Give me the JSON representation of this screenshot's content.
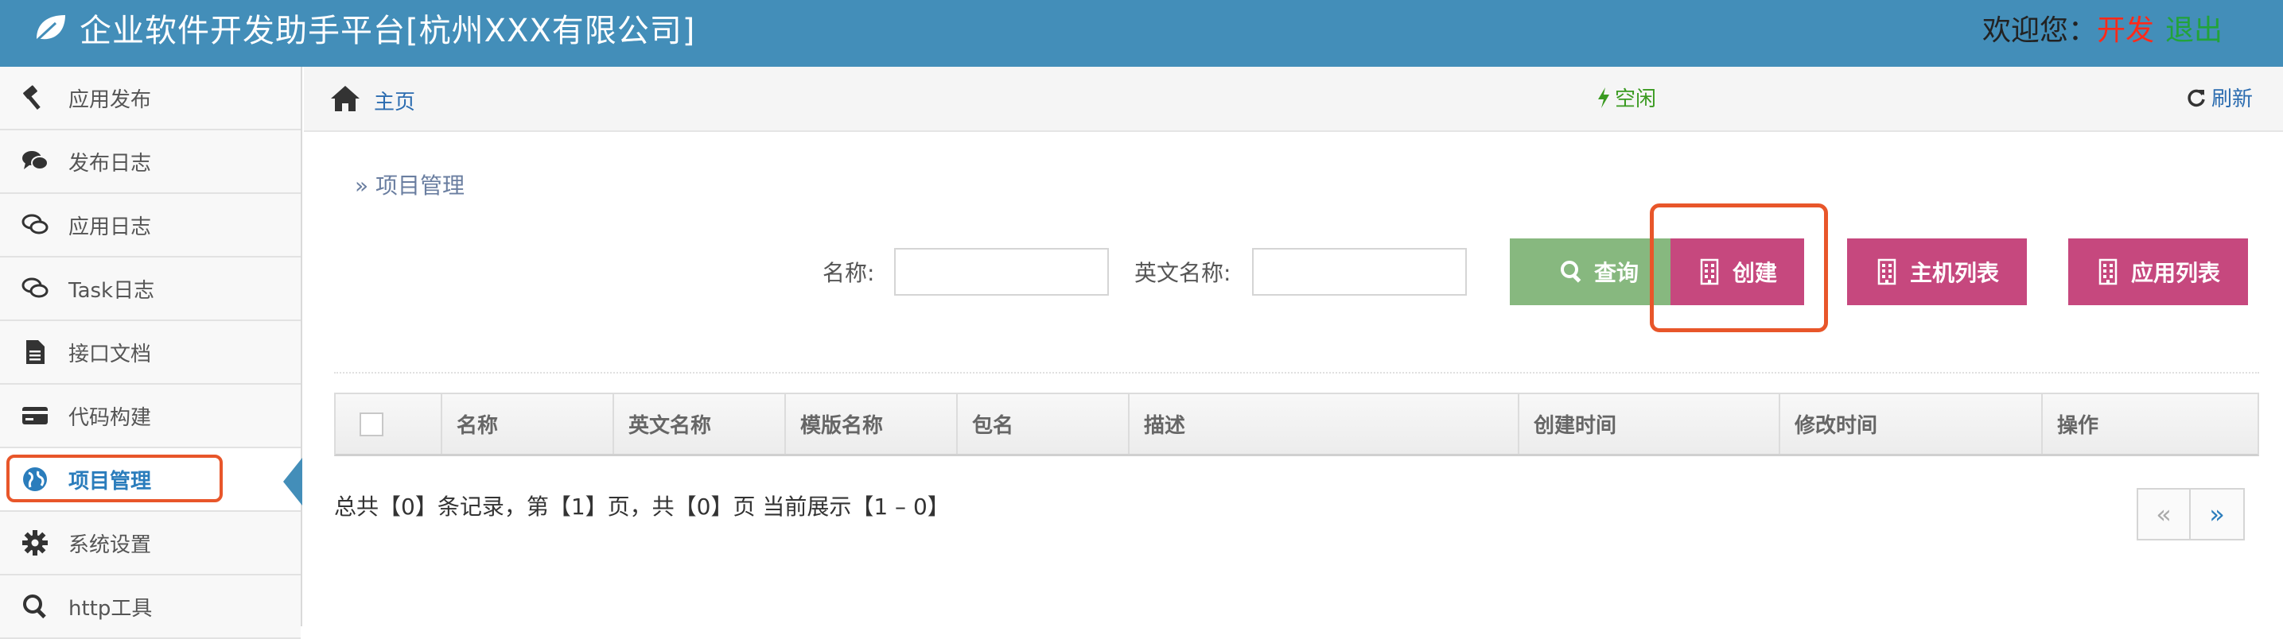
{
  "header": {
    "title": "企业软件开发助手平台[杭州XXX有限公司]",
    "welcome": "欢迎您：",
    "env": "开发",
    "logout": "退出"
  },
  "sidebar": {
    "items": [
      {
        "label": "应用发布",
        "icon": "hammer-icon"
      },
      {
        "label": "发布日志",
        "icon": "comments-icon"
      },
      {
        "label": "应用日志",
        "icon": "comments-outline-icon"
      },
      {
        "label": "Task日志",
        "icon": "comments-outline-icon"
      },
      {
        "label": "接口文档",
        "icon": "file-text-icon"
      },
      {
        "label": "代码构建",
        "icon": "credit-card-icon"
      },
      {
        "label": "项目管理",
        "icon": "globe-icon",
        "active": true
      },
      {
        "label": "系统设置",
        "icon": "gear-icon"
      },
      {
        "label": "http工具",
        "icon": "search-icon"
      }
    ]
  },
  "breadcrumb": {
    "home": "主页",
    "status": "空闲",
    "refresh": "刷新"
  },
  "page": {
    "title": "» 项目管理"
  },
  "search": {
    "name_label": "名称:",
    "name_value": "",
    "en_name_label": "英文名称:",
    "en_name_value": ""
  },
  "buttons": {
    "query": "查询",
    "create": "创建",
    "host_list": "主机列表",
    "app_list": "应用列表"
  },
  "table": {
    "columns": [
      "名称",
      "英文名称",
      "模版名称",
      "包名",
      "描述",
      "创建时间",
      "修改时间",
      "操作"
    ],
    "rows": []
  },
  "pagination": {
    "summary": "总共【0】条记录，第【1】页，共【0】页 当前展示【1 – 0】",
    "prev": "«",
    "next": "»"
  },
  "colors": {
    "header_bg": "#438eb9",
    "query_button": "#87b87f",
    "action_button": "#c6487e",
    "highlight_outline": "#e8562a"
  }
}
